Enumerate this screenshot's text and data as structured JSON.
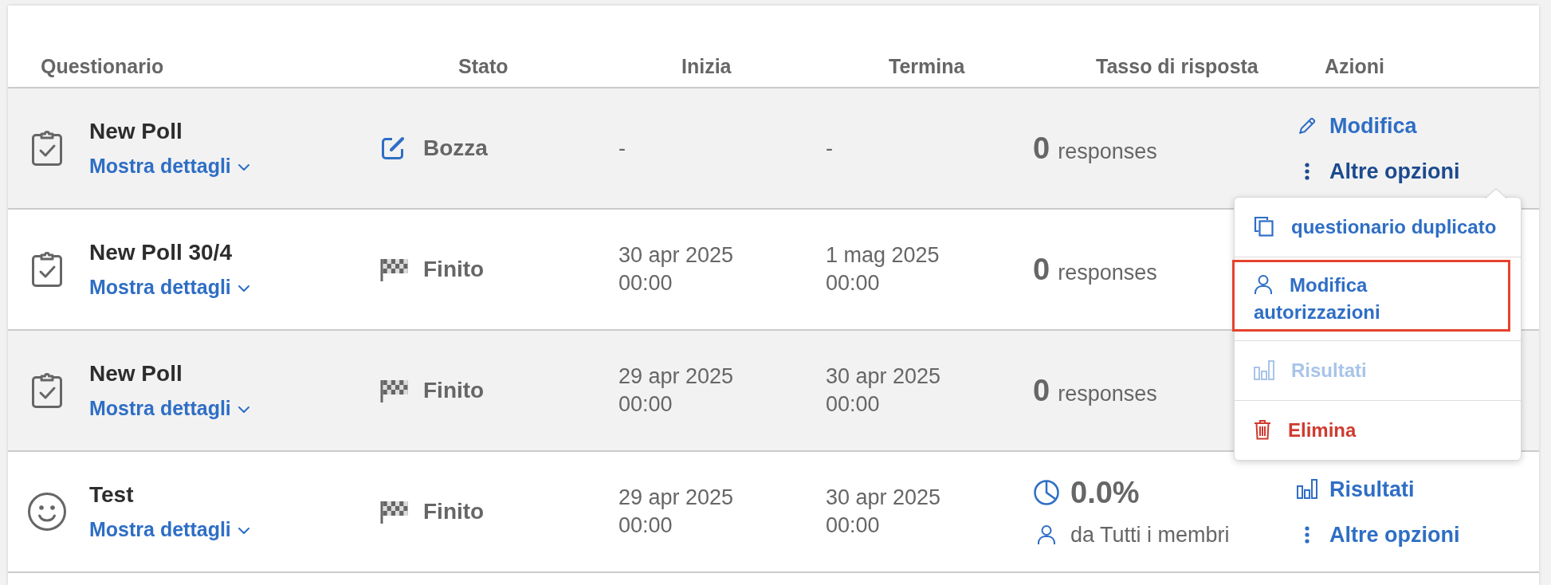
{
  "table": {
    "columns": [
      "Questionario",
      "Stato",
      "Inizia",
      "Termina",
      "Tasso di risposta",
      "Azioni"
    ],
    "rows": [
      {
        "kind": "poll",
        "title": "New Poll",
        "details": {
          "label": "Mostra dettagli",
          "expanded": false
        },
        "status": {
          "kind": "draft",
          "label": "Bozza"
        },
        "starts": "-",
        "ends": "-",
        "response_rate": {
          "kind": "count",
          "value": "0",
          "label": "responses"
        },
        "actions": [
          {
            "kind": "edit",
            "label": "Modifica",
            "expanded": false
          },
          {
            "kind": "more",
            "label": "Altre opzioni",
            "expanded": true,
            "menu": {
              "items": [
                {
                  "kind": "duplicate",
                  "label": "questionario duplicato",
                  "disabled": false,
                  "highlighted": false
                },
                {
                  "kind": "permissions",
                  "label": "Modifica autorizzazioni",
                  "disabled": false,
                  "highlighted": true
                },
                {
                  "kind": "results",
                  "label": "Risultati",
                  "disabled": true,
                  "highlighted": false
                },
                {
                  "kind": "delete",
                  "label": "Elimina",
                  "disabled": false,
                  "highlighted": false
                }
              ]
            }
          }
        ]
      },
      {
        "kind": "poll",
        "title": "New Poll 30/4",
        "details": {
          "label": "Mostra dettagli",
          "expanded": false
        },
        "status": {
          "kind": "finished",
          "label": "Finito"
        },
        "starts": "30 apr 2025 00:00",
        "ends": "1 mag 2025 00:00",
        "response_rate": {
          "kind": "count",
          "value": "0",
          "label": "responses"
        }
      },
      {
        "kind": "poll",
        "title": "New Poll",
        "details": {
          "label": "Mostra dettagli",
          "expanded": false
        },
        "status": {
          "kind": "finished",
          "label": "Finito"
        },
        "starts": "29 apr 2025 00:00",
        "ends": "30 apr 2025 00:00",
        "response_rate": {
          "kind": "count",
          "value": "0",
          "label": "responses"
        }
      },
      {
        "kind": "survey",
        "title": "Test",
        "details": {
          "label": "Mostra dettagli",
          "expanded": false
        },
        "status": {
          "kind": "finished",
          "label": "Finito"
        },
        "starts": "29 apr 2025 00:00",
        "ends": "30 apr 2025 00:00",
        "response_rate": {
          "kind": "percent",
          "value": "0.0%",
          "audience": "da Tutti i membri"
        },
        "actions": [
          {
            "kind": "results",
            "label": "Risultati",
            "expanded": false
          },
          {
            "kind": "more",
            "label": "Altre opzioni",
            "expanded": false
          }
        ]
      }
    ]
  }
}
